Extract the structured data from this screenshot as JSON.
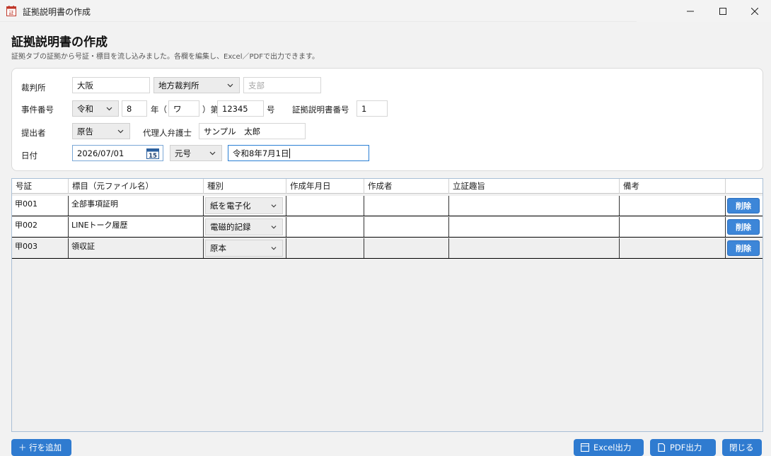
{
  "window": {
    "title": "証拠説明書の作成",
    "icon": "document-app-icon",
    "controls": [
      "minimize-icon",
      "maximize-icon",
      "close-icon"
    ]
  },
  "header": {
    "title": "証拠説明書の作成",
    "subtitle": "証拠タブの証拠から号証・標目を流し込みました。各欄を編集し、Excel／PDFで出力できます。"
  },
  "form": {
    "court_label": "裁判所",
    "court_name": "大阪",
    "court_type": "地方裁判所",
    "branch_placeholder": "支部",
    "case_label": "事件番号",
    "era": "令和",
    "case_year": "8",
    "year_char": "年（",
    "case_symbol": "ワ",
    "dai_char": "）第",
    "case_number": "12345",
    "go_char": "号",
    "evidence_no_label": "証拠説明書番号",
    "evidence_no": "1",
    "submitter_label": "提出者",
    "submitter": "原告",
    "attorney_label": "代理人弁護士",
    "attorney_name": "サンプル　太郎",
    "date_label": "日付",
    "date": "2026/07/01",
    "date_format": "元号",
    "date_display": "令和8年7月1日",
    "calendar_icon_day": "15"
  },
  "table": {
    "columns": [
      "号証",
      "標目（元ファイル名）",
      "種別",
      "作成年月日",
      "作成者",
      "立証趣旨",
      "備考",
      ""
    ],
    "rows": [
      {
        "no": "甲001",
        "title": "全部事項証明",
        "kind": "紙を電子化",
        "created": "",
        "author": "",
        "purpose": "",
        "note": "",
        "action": "削除"
      },
      {
        "no": "甲002",
        "title": "LINEトーク履歴",
        "kind": "電磁的記録",
        "created": "",
        "author": "",
        "purpose": "",
        "note": "",
        "action": "削除"
      },
      {
        "no": "甲003",
        "title": "領収証",
        "kind": "原本",
        "created": "",
        "author": "",
        "purpose": "",
        "note": "",
        "action": "削除"
      }
    ]
  },
  "footer": {
    "add_row": "＋ 行を追加",
    "excel": "Excel出力",
    "pdf": "PDF出力",
    "close": "閉じる"
  },
  "colors": {
    "accent": "#2f7bd0",
    "delete_button": "#3d86d8",
    "focus_border": "#2a7fd4"
  }
}
